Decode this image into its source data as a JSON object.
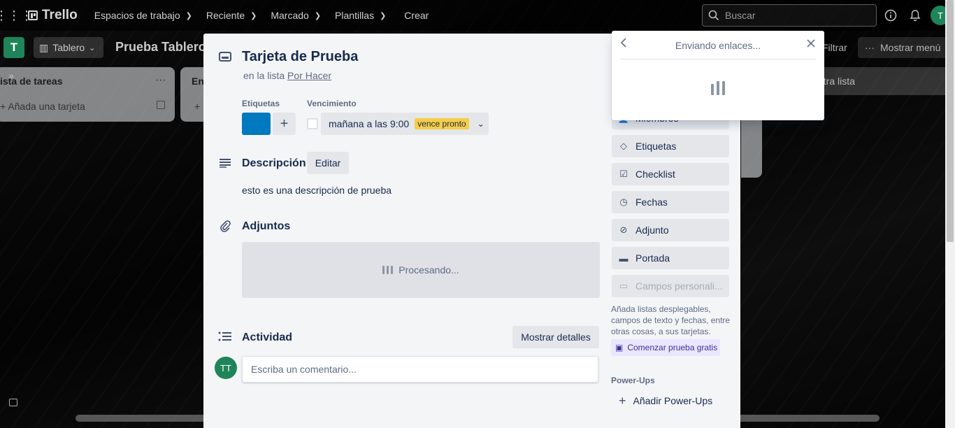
{
  "topbar": {
    "logo": "Trello",
    "nav": [
      "Espacios de trabajo",
      "Reciente",
      "Marcado",
      "Plantillas"
    ],
    "create": "Crear",
    "search_placeholder": "Buscar",
    "avatar": "T"
  },
  "board": {
    "workspace_badge": "T",
    "view": "Tablero",
    "title": "Prueba Tablero",
    "filter": "Filtrar",
    "menu": "Mostrar menú",
    "add_list": "otra lista"
  },
  "lists": [
    {
      "title": "ista de tareas",
      "add_card": "Añada una tarjeta"
    },
    {
      "title": "En",
      "add_card": ""
    }
  ],
  "card": {
    "title": "Tarjeta de Prueba",
    "in_list_prefix": "en la lista",
    "list_name": "Por Hacer",
    "labels_heading": "Etiquetas",
    "label_color": "#0079bf",
    "due_heading": "Vencimiento",
    "due_text": "mañana a las 9:00",
    "due_badge": "vence pronto",
    "description_heading": "Descripción",
    "edit": "Editar",
    "description": "esto es una descripción de prueba",
    "attachments_heading": "Adjuntos",
    "processing": "Procesando...",
    "activity_heading": "Actividad",
    "show_details": "Mostrar detalles",
    "comment_avatar": "TT",
    "comment_placeholder": "Escriba un comentario..."
  },
  "sidebar": {
    "buttons": [
      {
        "label": "Miembros",
        "icon": "person-icon"
      },
      {
        "label": "Etiquetas",
        "icon": "tag-icon"
      },
      {
        "label": "Checklist",
        "icon": "checkbox-icon"
      },
      {
        "label": "Fechas",
        "icon": "clock-icon"
      },
      {
        "label": "Adjunto",
        "icon": "paperclip-icon"
      },
      {
        "label": "Portada",
        "icon": "cover-icon"
      },
      {
        "label": "Campos personali...",
        "icon": "fields-icon"
      }
    ],
    "upsell": "Añada listas desplegables, campos de texto y fechas, entre otras cosas, a sus tarjetas.",
    "trial": "Comenzar prueba gratis",
    "powerups_heading": "Power-Ups",
    "add_powerups": "Añadir Power-Ups"
  },
  "popover": {
    "title": "Enviando enlaces..."
  }
}
